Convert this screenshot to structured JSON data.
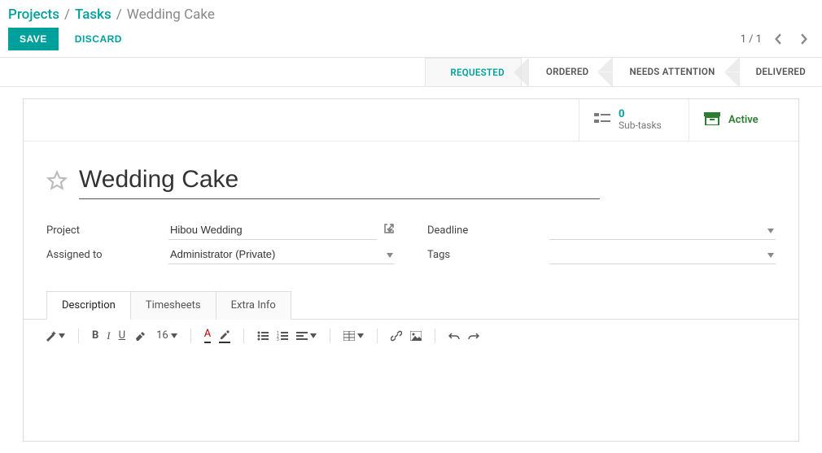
{
  "breadcrumb": {
    "projects": "Projects",
    "tasks": "Tasks",
    "current": "Wedding Cake"
  },
  "buttons": {
    "save": "SAVE",
    "discard": "DISCARD"
  },
  "pager": {
    "text": "1 / 1"
  },
  "status": {
    "requested": "REQUESTED",
    "ordered": "ORDERED",
    "needs_attention": "NEEDS ATTENTION",
    "delivered": "DELIVERED"
  },
  "stat": {
    "subtasks_count": "0",
    "subtasks_label": "Sub-tasks",
    "active_label": "Active"
  },
  "title": "Wedding Cake",
  "fields": {
    "project_label": "Project",
    "project_value": "Hibou Wedding",
    "assigned_label": "Assigned to",
    "assigned_value": "Administrator (Private)",
    "deadline_label": "Deadline",
    "deadline_value": "",
    "tags_label": "Tags",
    "tags_value": ""
  },
  "tabs": {
    "description": "Description",
    "timesheets": "Timesheets",
    "extra_info": "Extra Info"
  },
  "editor": {
    "font_size": "16"
  }
}
